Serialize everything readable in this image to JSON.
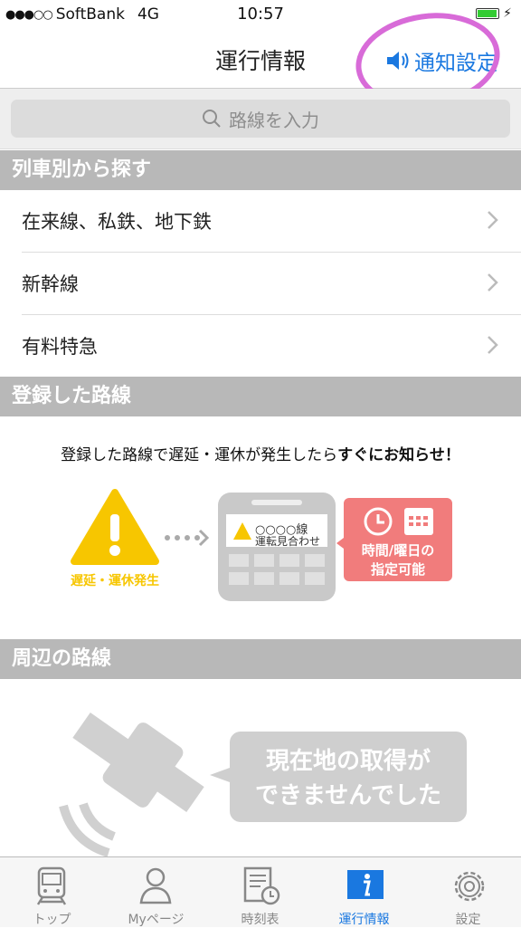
{
  "status": {
    "carrier": "SoftBank",
    "network": "4G",
    "time": "10:57"
  },
  "header": {
    "title": "運行情報",
    "notify_label": "通知設定"
  },
  "search": {
    "placeholder": "路線を入力"
  },
  "sections": {
    "by_train": "列車別から探す",
    "registered": "登録した路線",
    "nearby": "周辺の路線"
  },
  "train_types": [
    {
      "label": "在来線、私鉄、地下鉄"
    },
    {
      "label": "新幹線"
    },
    {
      "label": "有料特急"
    }
  ],
  "registered": {
    "message_prefix": "登録した路線で遅延・運休が発生したら",
    "message_emphasis": "すぐにお知らせ",
    "message_suffix": "！",
    "warning_label": "遅延・運休発生",
    "phone_line1": "○○○○線",
    "phone_line2": "運転見合わせ",
    "schedule_line1": "時間/曜日の",
    "schedule_line2": "指定可能"
  },
  "nearby": {
    "bubble_line1": "現在地の取得が",
    "bubble_line2": "できませんでした"
  },
  "tabs": [
    {
      "label": "トップ",
      "icon": "train-icon"
    },
    {
      "label": "Myページ",
      "icon": "person-icon"
    },
    {
      "label": "時刻表",
      "icon": "timetable-icon"
    },
    {
      "label": "運行情報",
      "icon": "info-icon",
      "active": true
    },
    {
      "label": "設定",
      "icon": "gear-icon"
    }
  ],
  "colors": {
    "accent": "#1a78e0",
    "section_bg": "#b8b8b8",
    "warning": "#f7c600",
    "schedule": "#f17c7c",
    "annotation": "#d86bd8"
  }
}
